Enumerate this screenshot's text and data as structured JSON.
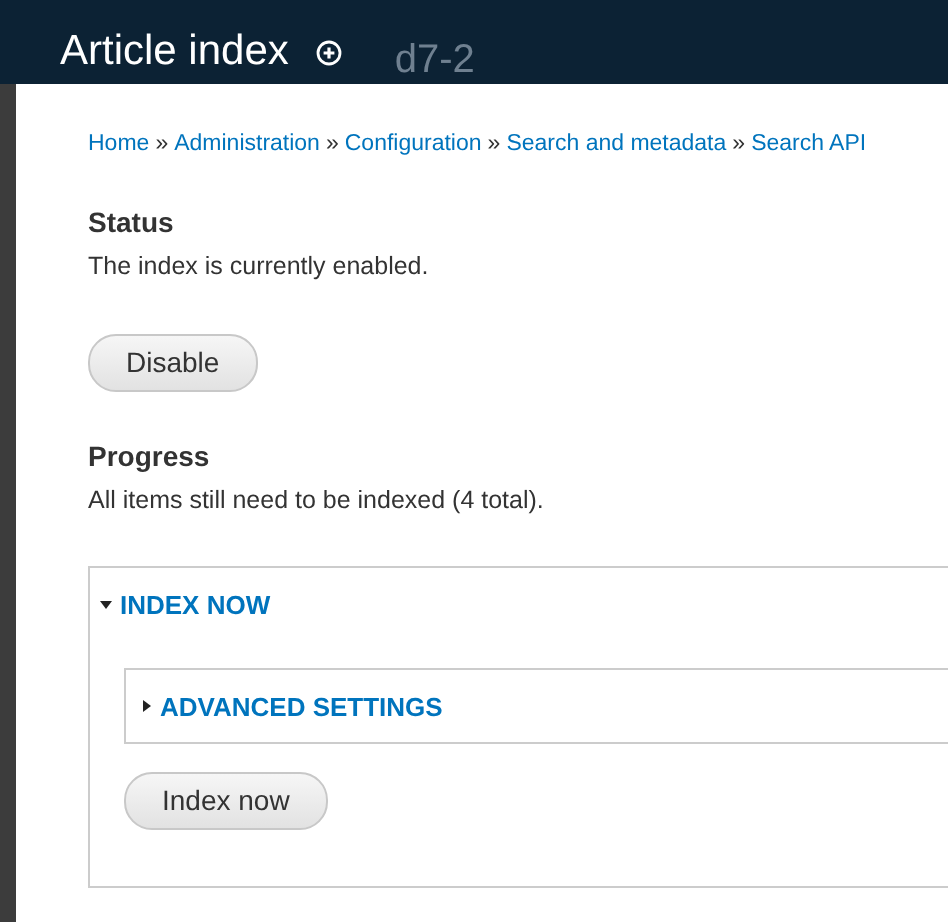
{
  "header": {
    "title": "Article index",
    "site_name": "d7-2"
  },
  "breadcrumb": {
    "separator": "»",
    "items": [
      "Home",
      "Administration",
      "Configuration",
      "Search and metadata",
      "Search API"
    ]
  },
  "sections": [
    {
      "heading": "Status",
      "text": "The index is currently enabled.",
      "button": "Disable"
    },
    {
      "heading": "Progress",
      "text": "All items still need to be indexed (4 total)."
    }
  ],
  "fieldset": {
    "legend": "INDEX NOW",
    "expanded": true,
    "children": [
      {
        "legend": "ADVANCED SETTINGS",
        "expanded": false
      }
    ],
    "button": "Index now"
  }
}
